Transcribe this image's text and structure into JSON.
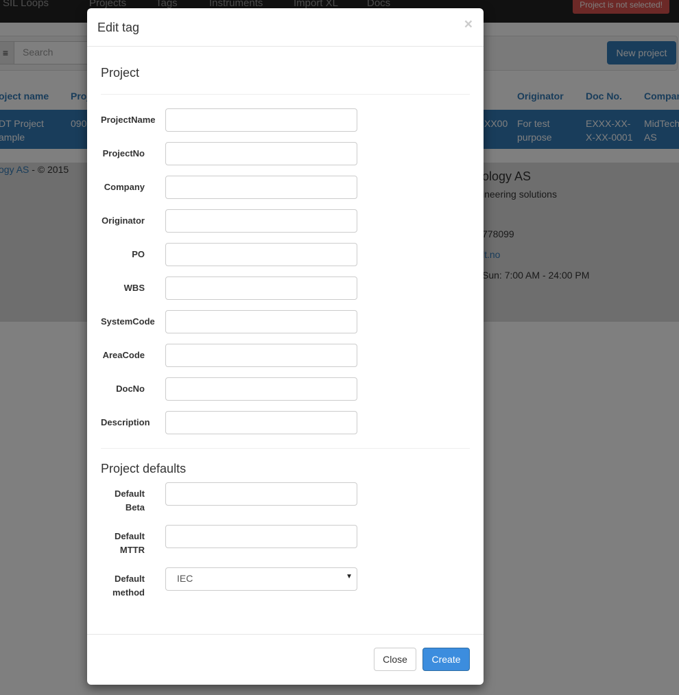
{
  "nav": {
    "items": [
      "SIL Loops",
      "Projects",
      "Tags",
      "Instruments",
      "Import XL",
      "Docs"
    ],
    "warning": "Project is not selected!"
  },
  "toolbar": {
    "search_placeholder": "Search",
    "new_project": "New project"
  },
  "table": {
    "headers": [
      "oject name",
      "Proj",
      "",
      "Originator",
      "Doc No.",
      "Compan"
    ],
    "row": [
      "DT Project\nample",
      "090",
      "XX00",
      "For test\npurpose",
      "EXXX-XX-\nX-XX-0001",
      "MidTech\nAS"
    ]
  },
  "footer": {
    "company_link": "ogy AS",
    "copyright": " - © 2015",
    "company": "ology AS",
    "tagline": "ineering solutions",
    "phone": "778099",
    "email": "lt.no",
    "hours": "Sun: 7:00 AM - 24:00 PM"
  },
  "modal": {
    "title": "Edit tag",
    "close_x": "×",
    "section_project": "Project",
    "section_defaults": "Project defaults",
    "fields": [
      {
        "label": "ProjectName",
        "value": ""
      },
      {
        "label": "ProjectNo",
        "value": ""
      },
      {
        "label": "Company",
        "value": ""
      },
      {
        "label": "Originator",
        "value": ""
      },
      {
        "label": "PO",
        "value": ""
      },
      {
        "label": "WBS",
        "value": ""
      },
      {
        "label": "SystemCode",
        "value": ""
      },
      {
        "label": "AreaCode",
        "value": ""
      },
      {
        "label": "DocNo",
        "value": ""
      },
      {
        "label": "Description",
        "value": ""
      }
    ],
    "defaults": [
      {
        "label": "Default Beta",
        "value": ""
      },
      {
        "label": "Default MTTR",
        "value": ""
      },
      {
        "label": "Default method",
        "value": "IEC"
      }
    ],
    "close": "Close",
    "create": "Create"
  },
  "colors": {
    "primary": "#337ab7",
    "danger": "#d9534f"
  }
}
